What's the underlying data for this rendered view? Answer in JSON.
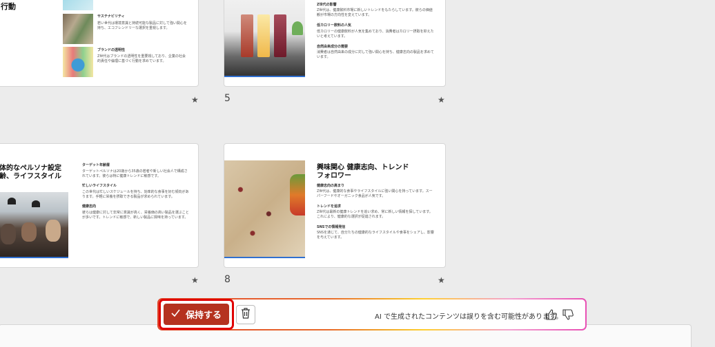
{
  "slides": {
    "s4": {
      "title": "行動",
      "items": [
        {
          "heading": "サステナビリティ",
          "body": "若い世代は環境意識と持続可能な製品に対して強い関心を持ち、エコフレンドリーな選択を重視します。"
        },
        {
          "heading": "ブランドの透明性",
          "body": "Z世代はブランドの透明性を重要視しており、企業の社会的責任や倫理に基づく行動を求めています。"
        }
      ]
    },
    "s5": {
      "number": "5",
      "items": [
        {
          "heading": "Z世代の影響",
          "body": "Z世代は、健康飲料市場に新しいトレンドをもたらしています。彼らの価値観が市場の方向性を変えています。"
        },
        {
          "heading": "低カロリー飲料の人気",
          "body": "低カロリーの健康飲料が人気を集めており、消費者はカロリー摂取を抑えたいと考えています。"
        },
        {
          "heading": "自然由来成分の需要",
          "body": "消費者は自然由来の成分に対して強い関心を持ち、健康志向の製品を求めています。"
        }
      ]
    },
    "s7": {
      "title_line1": "体的なペルソナ設定",
      "title_line2": "齢、ライフスタイル",
      "items": [
        {
          "heading": "ターゲット年齢層",
          "body": "ターゲットペルソナは20歳から35歳の若者や新しい社会人で構成されています。彼らは特に健康トレンドに敏感です。"
        },
        {
          "heading": "忙しいライフスタイル",
          "body": "この世代は忙しいスケジュールを持ち、効率的な食事を好む傾向があります。手軽に栄養を摂取できる製品が求められています。"
        },
        {
          "heading": "健康志向",
          "body": "彼らは健康に対して非常に意識が高く、栄養価の高い製品を選ぶことが多いです。トレンドに敏感で、新しい製品に興味を持っています。"
        }
      ]
    },
    "s8": {
      "number": "8",
      "title_line1": "興味関心 健康志向、トレンド",
      "title_line2": "フォロワー",
      "items": [
        {
          "heading": "健康志向の高まり",
          "body": "Z世代は、健康的な食事やライフスタイルに強い関心を持っています。スーパーフードやオーガニック食品が人気です。"
        },
        {
          "heading": "トレンドを追求",
          "body": "Z世代は最新の健康トレンドを追い求め、常に新しい情報を探しています。これにより、健康的な選択が促進されます。"
        },
        {
          "heading": "SNSでの情報発信",
          "body": "SNSを通じて、自分たちの健康的なライフスタイルや食事をシェアし、影響を与えています。"
        }
      ]
    }
  },
  "toolbar": {
    "keep_label": "保持する",
    "disclaimer": "AI で生成されたコンテンツは誤りを含む可能性があります。"
  },
  "star_glyph": "★"
}
